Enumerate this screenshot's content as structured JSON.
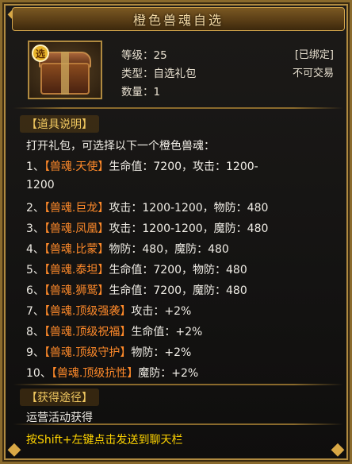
{
  "title": "橙色兽魂自选",
  "icon": {
    "name": "treasure-chest-icon",
    "badge": "选"
  },
  "info": {
    "level": "等级：25",
    "type": "类型：自选礼包",
    "count": "数量：1",
    "tag_bound": "[已绑定]",
    "tag_trade": "不可交易"
  },
  "desc": {
    "header": "【道具说明】",
    "intro": "打开礼包，可选择以下一个橙色兽魂：",
    "items": [
      {
        "idx": "1、",
        "name": "【兽魂.天使】",
        "stat": "生命值：7200，攻击：1200-",
        "wrap": "1200"
      },
      {
        "idx": "2、",
        "name": "【兽魂.巨龙】",
        "stat": "攻击：1200-1200，物防：480"
      },
      {
        "idx": "3、",
        "name": "【兽魂.凤凰】",
        "stat": "攻击：1200-1200，魔防：480"
      },
      {
        "idx": "4、",
        "name": "【兽魂.比蒙】",
        "stat": "物防：480，魔防：480"
      },
      {
        "idx": "5、",
        "name": "【兽魂.泰坦】",
        "stat": "生命值：7200，物防：480"
      },
      {
        "idx": "6、",
        "name": "【兽魂.狮鹫】",
        "stat": "生命值：7200，魔防：480"
      },
      {
        "idx": "7、",
        "name": "【兽魂.顶级强袭】",
        "stat": "攻击：+2%"
      },
      {
        "idx": "8、",
        "name": "【兽魂.顶级祝福】",
        "stat": "生命值：+2%"
      },
      {
        "idx": "9、",
        "name": "【兽魂.顶级守护】",
        "stat": "物防：+2%"
      },
      {
        "idx": "10、",
        "name": "【兽魂.顶级抗性】",
        "stat": "魔防：+2%"
      }
    ]
  },
  "source": {
    "header": "【获得途径】",
    "text": "运营活动获得"
  },
  "footer": "按Shift+左键点击发送到聊天栏",
  "colors": {
    "accent": "#ff8a2a",
    "gold": "#f0c860",
    "footer": "#ffd400"
  }
}
